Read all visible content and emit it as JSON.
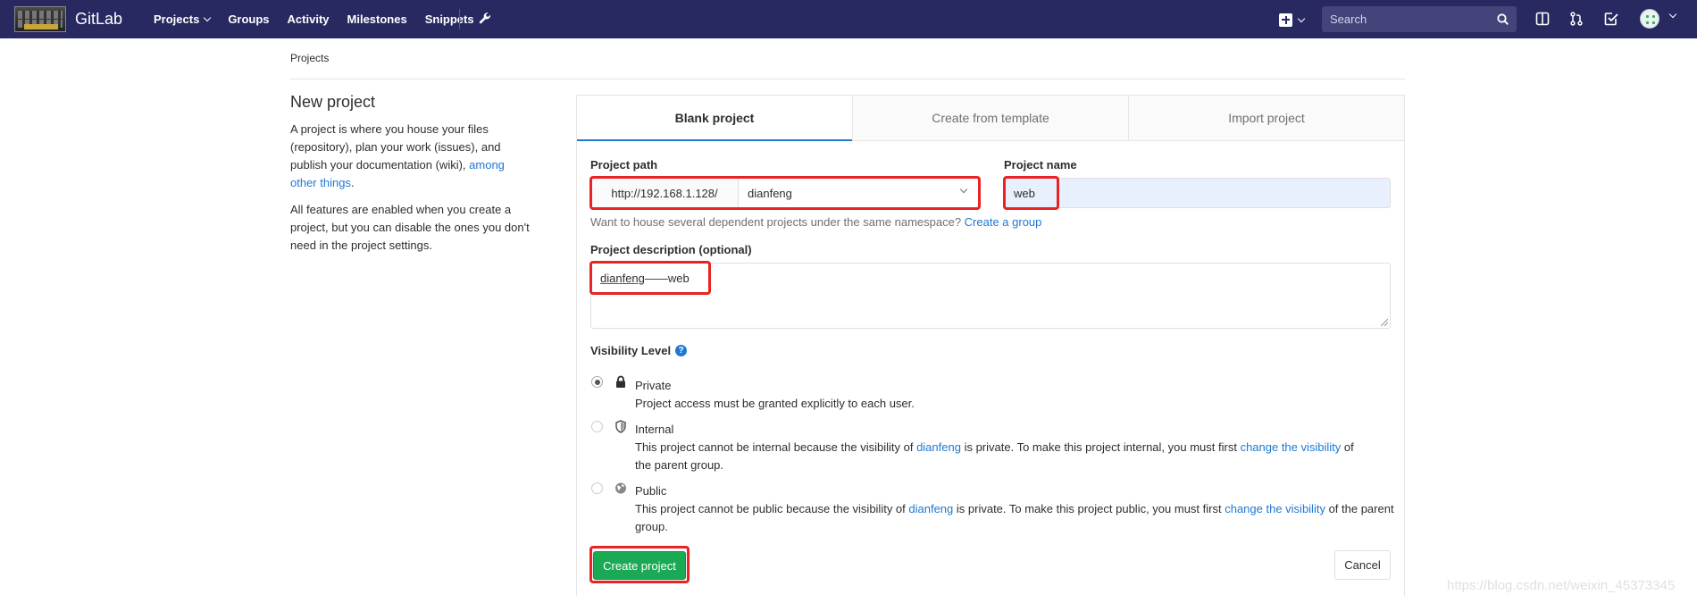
{
  "navbar": {
    "brand": "GitLab",
    "links": [
      "Projects",
      "Groups",
      "Activity",
      "Milestones",
      "Snippets"
    ],
    "search_placeholder": "Search"
  },
  "breadcrumb": "Projects",
  "left": {
    "title": "New project",
    "p1_text": "A project is where you house your files (repository), plan your work (issues), and publish your documentation (wiki), ",
    "p1_link": "among other things",
    "p1_end": ".",
    "p2_text": "All features are enabled when you create a project, but you can disable the ones you don't need in the project settings."
  },
  "tabs": [
    "Blank project",
    "Create from template",
    "Import project"
  ],
  "form": {
    "path_label": "Project path",
    "path_prefix": "http://192.168.1.128/",
    "path_namespace": "dianfeng",
    "name_label": "Project name",
    "name_value": "web",
    "helper_text": "Want to house several dependent projects under the same namespace? ",
    "helper_link": "Create a group",
    "desc_label": "Project description (optional)",
    "desc_value_a": "dianfeng",
    "desc_value_b": "——web",
    "visibility_label": "Visibility Level"
  },
  "visibility": {
    "private_title": "Private",
    "private_desc": "Project access must be granted explicitly to each user.",
    "internal_title": "Internal",
    "internal_d1": "This project cannot be internal because the visibility of ",
    "internal_link1": "dianfeng",
    "internal_d2": " is private. To make this project internal, you must first ",
    "internal_link2": "change the visibility",
    "internal_d3": " of the parent group.",
    "public_title": "Public",
    "public_d1": "This project cannot be public because the visibility of ",
    "public_link1": "dianfeng",
    "public_d2": " is private. To make this project public, you must first ",
    "public_link2": "change the visibility",
    "public_d3": " of the parent group."
  },
  "buttons": {
    "create": "Create project",
    "cancel": "Cancel"
  },
  "watermark": "https://blog.csdn.net/weixin_45373345",
  "colors": {
    "navbar": "#292961",
    "create_button": "#1aaa55",
    "highlight": "#e82323",
    "link": "#1f78d1"
  }
}
